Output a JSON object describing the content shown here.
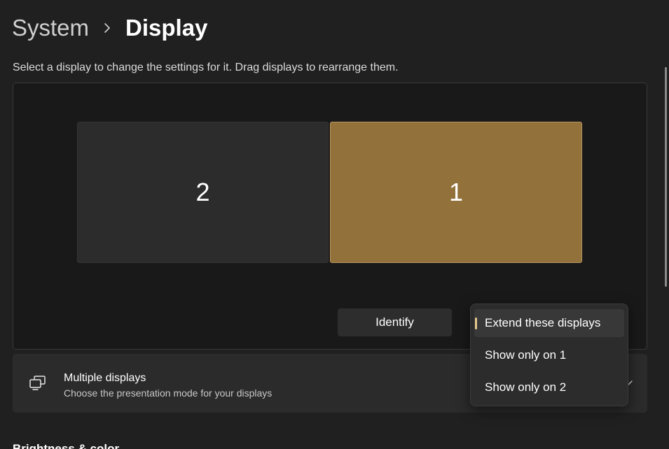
{
  "breadcrumb": {
    "parent": "System",
    "current": "Display",
    "separator_icon": "chevron-right-icon"
  },
  "hint_text": "Select a display to change the settings for it. Drag displays to rearrange them.",
  "arrangement": {
    "monitors": [
      {
        "label": "2",
        "selected": false
      },
      {
        "label": "1",
        "selected": true
      }
    ],
    "identify_label": "Identify"
  },
  "multiple_displays": {
    "icon": "multiple-displays-icon",
    "title": "Multiple displays",
    "subtitle": "Choose the presentation mode for your displays",
    "chevron_icon": "chevron-down-icon",
    "options": [
      {
        "label": "Extend these displays",
        "selected": true
      },
      {
        "label": "Show only on 1",
        "selected": false
      },
      {
        "label": "Show only on 2",
        "selected": false
      }
    ]
  },
  "next_section_heading": "Brightness & color",
  "colors": {
    "background": "#202020",
    "accent": "#93713a",
    "selection_indicator": "#e4c98d"
  }
}
